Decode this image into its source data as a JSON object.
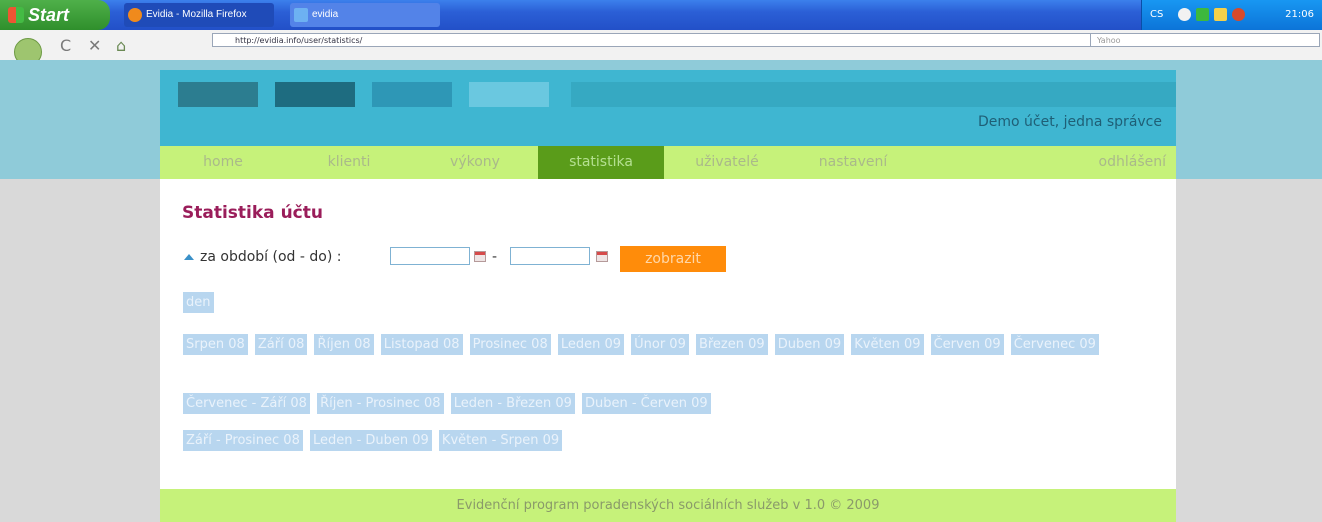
{
  "taskbar": {
    "start_label": "Start",
    "tasks": [
      "Evidia - Mozilla Firefox",
      "evidia"
    ],
    "tray_lang": "CS",
    "time": "21:06"
  },
  "browser": {
    "url": "http://evidia.info/user/statistics/",
    "search_placeholder": "Yahoo"
  },
  "header": {
    "account": "Demo účet, jedna správce"
  },
  "menu": {
    "items": [
      "home",
      "klienti",
      "výkony",
      "statistika",
      "uživatelé",
      "nastavení"
    ],
    "active_index": 3,
    "logout": "odhlášení"
  },
  "page": {
    "title": "Statistika účtu",
    "filter_label": "za období (od - do) :",
    "date_from": "",
    "date_to": "",
    "dash": "-",
    "show_button": "zobrazit",
    "day_tag": "den",
    "months": [
      "Srpen 08",
      "Září 08",
      "Říjen 08",
      "Listopad 08",
      "Prosinec 08",
      "Leden 09",
      "Únor 09",
      "Březen 09",
      "Duben 09",
      "Květen 09",
      "Červen 09",
      "Červenec 09"
    ],
    "quarters": [
      "Červenec - Září 08",
      "Říjen - Prosinec 08",
      "Leden - Březen 09",
      "Duben - Červen 09"
    ],
    "thirds": [
      "Září - Prosinec 08",
      "Leden - Duben 09",
      "Květen - Srpen 09"
    ]
  },
  "footer": {
    "text": "Evidenční program poradenských sociálních služeb v 1.0 © 2009"
  },
  "colors": {
    "header_bg": "#3fb6d1",
    "menu_bg": "#c6f27a",
    "menu_active": "#5a9c1a",
    "title": "#9a1d5a",
    "button": "#ff8c0a",
    "tag": "#b8d6ef"
  }
}
